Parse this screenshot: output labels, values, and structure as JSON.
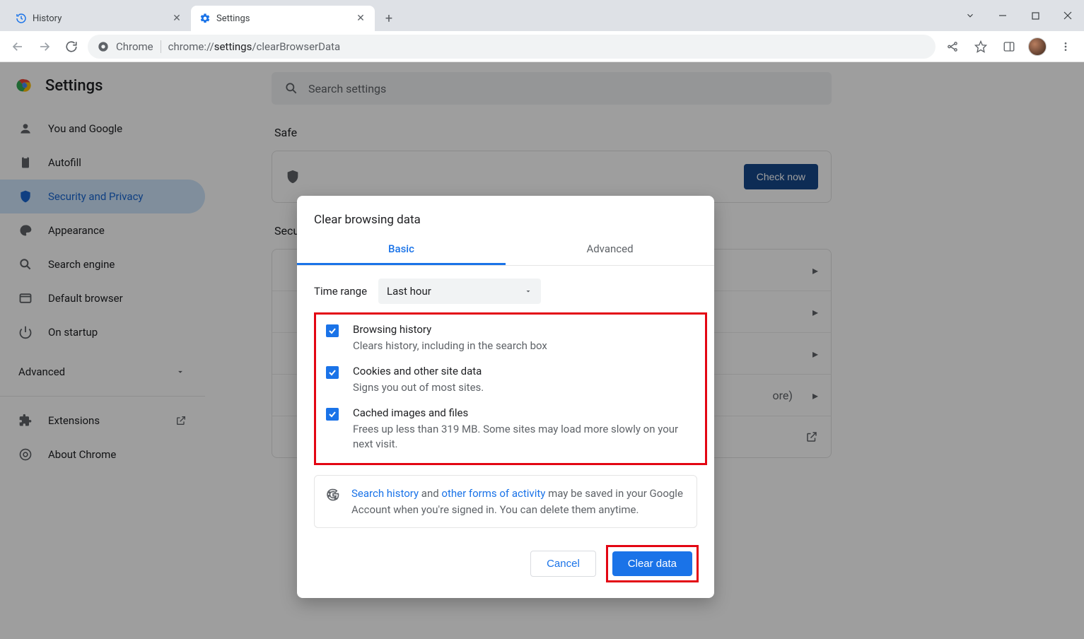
{
  "tabs": [
    {
      "title": "History"
    },
    {
      "title": "Settings"
    }
  ],
  "omnibox": {
    "scheme_label": "Chrome",
    "path_prefix": "chrome://",
    "path_bold": "settings",
    "path_suffix": "/clearBrowserData"
  },
  "settings": {
    "title": "Settings",
    "search_placeholder": "Search settings",
    "sidebar": {
      "items": [
        {
          "label": "You and Google"
        },
        {
          "label": "Autofill"
        },
        {
          "label": "Security and Privacy"
        },
        {
          "label": "Appearance"
        },
        {
          "label": "Search engine"
        },
        {
          "label": "Default browser"
        },
        {
          "label": "On startup"
        }
      ],
      "advanced": "Advanced",
      "extensions": "Extensions",
      "about": "About Chrome"
    },
    "content": {
      "section1": "Safe",
      "check_now": "Check now",
      "section2": "Secu",
      "more_suffix": "ore)"
    }
  },
  "dialog": {
    "title": "Clear browsing data",
    "tab_basic": "Basic",
    "tab_advanced": "Advanced",
    "time_range_label": "Time range",
    "time_range_value": "Last hour",
    "options": [
      {
        "title": "Browsing history",
        "desc": "Clears history, including in the search box"
      },
      {
        "title": "Cookies and other site data",
        "desc": "Signs you out of most sites."
      },
      {
        "title": "Cached images and files",
        "desc": "Frees up less than 319 MB. Some sites may load more slowly on your next visit."
      }
    ],
    "info": {
      "link1": "Search history",
      "mid1": " and ",
      "link2": "other forms of activity",
      "rest": " may be saved in your Google Account when you're signed in. You can delete them anytime."
    },
    "cancel": "Cancel",
    "clear": "Clear data"
  }
}
